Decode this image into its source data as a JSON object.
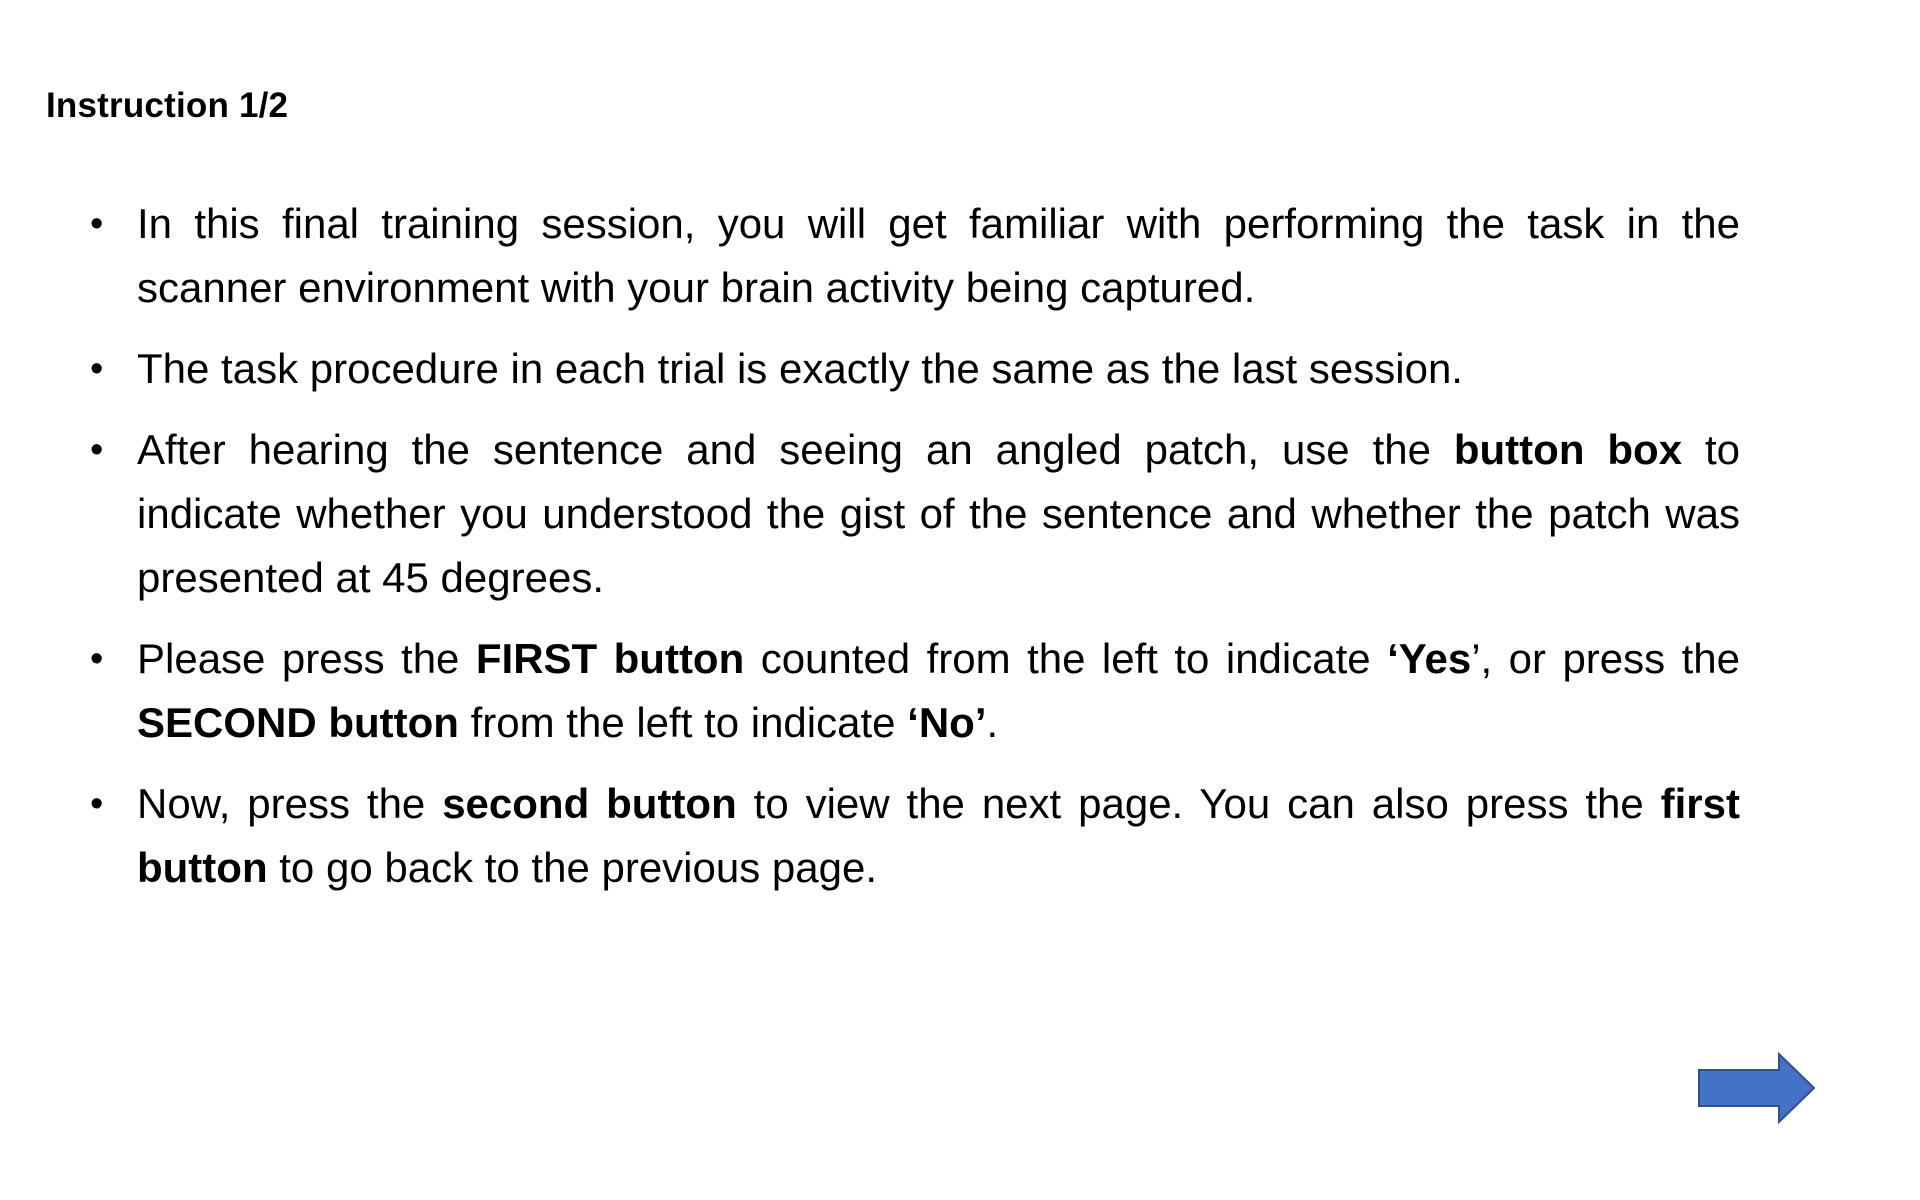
{
  "slide": {
    "title": "Instruction 1/2"
  },
  "bullets": [
    {
      "segments": [
        {
          "text": "In this final training session, you will get familiar with performing the task in the scanner environment with your brain activity being captured.",
          "bold": false
        }
      ]
    },
    {
      "segments": [
        {
          "text": "The task procedure in each trial is exactly the same as the last session.",
          "bold": false
        }
      ]
    },
    {
      "segments": [
        {
          "text": "After hearing the sentence and seeing an angled patch, use the ",
          "bold": false
        },
        {
          "text": "button box",
          "bold": true
        },
        {
          "text": " to indicate whether you understood the gist of the sentence and whether the patch was presented at 45 degrees.",
          "bold": false
        }
      ]
    },
    {
      "segments": [
        {
          "text": "Please press the ",
          "bold": false
        },
        {
          "text": "FIRST button",
          "bold": true
        },
        {
          "text": " counted from the left to indicate ",
          "bold": false
        },
        {
          "text": "‘Yes",
          "bold": true
        },
        {
          "text": "’, or press the ",
          "bold": false
        },
        {
          "text": "SECOND button",
          "bold": true
        },
        {
          "text": " from the left to indicate ",
          "bold": false
        },
        {
          "text": "‘No’",
          "bold": true
        },
        {
          "text": ".",
          "bold": false
        }
      ]
    },
    {
      "segments": [
        {
          "text": "Now, press the ",
          "bold": false
        },
        {
          "text": "second button",
          "bold": true
        },
        {
          "text": " to view the next page. You can also press the ",
          "bold": false
        },
        {
          "text": "first button",
          "bold": true
        },
        {
          "text": " to go back to the previous page.",
          "bold": false
        }
      ]
    }
  ],
  "bullet_glyph": "•",
  "next_arrow": {
    "icon": "right-arrow-icon",
    "fill": "#4472C4",
    "stroke": "#2F528F"
  }
}
